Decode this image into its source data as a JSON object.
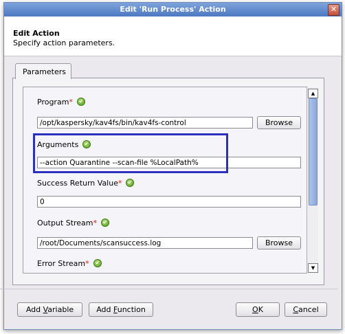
{
  "window": {
    "title": "Edit 'Run Process' Action",
    "close_glyph": "✕"
  },
  "header": {
    "title": "Edit Action",
    "subtitle": "Specify action parameters."
  },
  "tabs": [
    {
      "label": "Parameters"
    }
  ],
  "form": {
    "program": {
      "label": "Program",
      "required": true,
      "value": "/opt/kaspersky/kav4fs/bin/kav4fs-control",
      "browse_label": "Browse"
    },
    "arguments": {
      "label": "Arguments",
      "required": false,
      "value": "--action Quarantine --scan-file %LocalPath%"
    },
    "success_return": {
      "label": "Success Return Value",
      "required": true,
      "value": "0"
    },
    "output_stream": {
      "label": "Output Stream",
      "required": true,
      "value": "/root/Documents/scansuccess.log",
      "browse_label": "Browse"
    },
    "error_stream": {
      "label": "Error Stream",
      "required": true
    }
  },
  "required_mark": "*",
  "scrollbar": {
    "up_glyph": "▲",
    "down_glyph": "▼"
  },
  "buttons": {
    "add_variable": {
      "prefix": "Add ",
      "mnemonic": "V",
      "suffix": "ariable"
    },
    "add_function": {
      "prefix": "Add ",
      "mnemonic": "F",
      "suffix": "unction"
    },
    "ok": {
      "mnemonic": "O",
      "suffix": "K"
    },
    "cancel": {
      "mnemonic": "C",
      "suffix": "ancel"
    }
  },
  "colors": {
    "highlight_box": "#2a2fbf",
    "titlebar": "#4d79c1",
    "required": "#d42020",
    "valid_icon": "#4e9a1c"
  }
}
